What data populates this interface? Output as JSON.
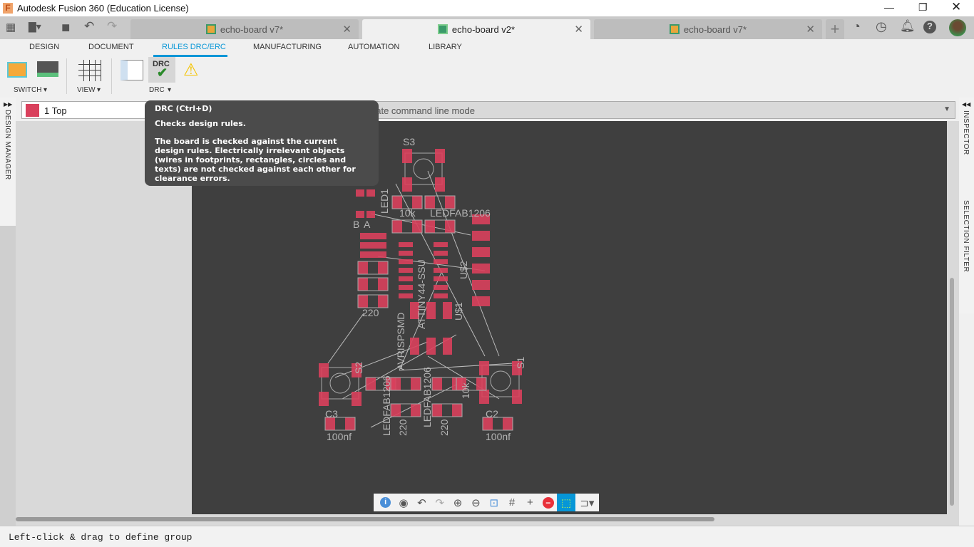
{
  "app": {
    "title": "Autodesk Fusion 360 (Education License)"
  },
  "tabs": [
    {
      "label": "echo-board v7*",
      "active": false
    },
    {
      "label": "echo-board v2*",
      "active": true
    },
    {
      "label": "echo-board v7*",
      "active": false
    }
  ],
  "ribbon": {
    "tabs": [
      "DESIGN",
      "DOCUMENT",
      "RULES DRC/ERC",
      "MANUFACTURING",
      "AUTOMATION",
      "LIBRARY"
    ],
    "active_tab": "RULES DRC/ERC",
    "groups": [
      "SWITCH",
      "VIEW",
      "DRC"
    ],
    "drc_icon_text": "DRC"
  },
  "layer": {
    "value": "1 Top",
    "color": "#d9405c"
  },
  "command_line": {
    "placeholder": "Activate command line mode",
    "visible_text": "vate command line mode"
  },
  "tooltip": {
    "title": "DRC (Ctrl+D)",
    "subtitle": "Checks design rules.",
    "body": "The board is checked against the current design rules. Electrically irrelevant objects (wires in footprints, rectangles, circles and texts) are not checked against each other for clearance errors."
  },
  "panels": {
    "left": "DESIGN MANAGER",
    "right_top": "INSPECTOR",
    "right_bottom": "SELECTION FILTER"
  },
  "status": "Left-click & drag to define group",
  "pcb_labels": [
    "S3",
    "S2",
    "S1",
    "LED1",
    "B",
    "A",
    "C3",
    "C2",
    "100nf",
    "100nf",
    "10k",
    "10k",
    "220",
    "220",
    "220",
    "U$2",
    "U$1",
    "AVRISPSMD",
    "ATTINY44-SSU",
    "LEDFAB1206",
    "LEDFAB1206",
    "LEDFAB1206"
  ],
  "colors": {
    "accent": "#0696d7",
    "pad": "#d9405c",
    "board": "#3f3f3f"
  }
}
